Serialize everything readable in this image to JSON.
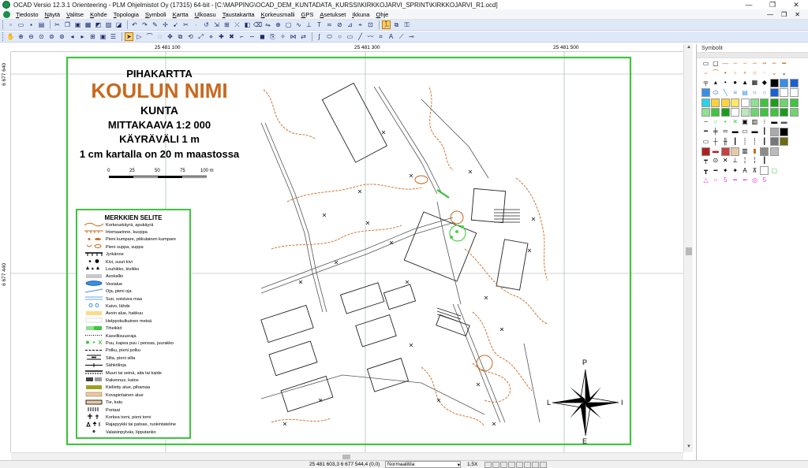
{
  "window": {
    "title": "OCAD Versio 12.3.1  Orienteering - PLM Ohjelmistot Oy (17315) 64-bit - [C:\\MAPPING\\OCAD_DEM_KUNTADATA_KURSSI\\KIRKKOJARVI_SPRINT\\KIRKKOJARVI_R1.ocd]",
    "minimize": "—",
    "maximize": "❐",
    "close": "✕"
  },
  "menu": [
    {
      "label": "Tiedosto"
    },
    {
      "label": "Näytä"
    },
    {
      "label": "Valitse"
    },
    {
      "label": "Kohde"
    },
    {
      "label": "Topologia"
    },
    {
      "label": "Symboli"
    },
    {
      "label": "Kartta"
    },
    {
      "label": "Ulkoasu"
    },
    {
      "label": "Taustakartta"
    },
    {
      "label": "Korkeusmalli"
    },
    {
      "label": "GPS"
    },
    {
      "label": "Asetukset"
    },
    {
      "label": "Ikkuna"
    },
    {
      "label": "Ohje"
    }
  ],
  "mdi_buttons": {
    "minimize": "—",
    "restore": "❐",
    "close": "✕"
  },
  "ruler": {
    "x_labels": [
      "25 481 100",
      "25 481 300",
      "25 481 500"
    ],
    "y_labels": [
      "6 677 640",
      "6 677 440"
    ]
  },
  "sheet": {
    "heading": "PIHAKARTTA",
    "school": "KOULUN NIMI",
    "municipality": "KUNTA",
    "scale": "MITTAKAAVA 1:2 000",
    "contour": "KÄYRÄVÄLI 1 m",
    "cm_note": "1 cm kartalla on 20 m maastossa",
    "scale_bar_labels": [
      "0",
      "25",
      "50",
      "75",
      "100 m"
    ],
    "compass": {
      "north": "P",
      "south": "E",
      "west": "L",
      "east": "I"
    }
  },
  "legend": {
    "title": "MERKKIEN SELITE",
    "items": [
      {
        "label": "Korkeuskäyrä, apukäyrä",
        "symbol": "contour-line"
      },
      {
        "label": "Irtomaarinne, kuoppa",
        "symbol": "earth-bank"
      },
      {
        "label": "Pieni kumpare, pitkulainen kumpare",
        "symbol": "knoll"
      },
      {
        "label": "Pieni suppa, suppa",
        "symbol": "depression"
      },
      {
        "label": "Jyrkänne",
        "symbol": "cliff"
      },
      {
        "label": "Kivi, suuri kivi",
        "symbol": "boulder"
      },
      {
        "label": "Louhikko, kivikko",
        "symbol": "boulder-field"
      },
      {
        "label": "Avokallio",
        "symbol": "bare-rock"
      },
      {
        "label": "Vesialue",
        "symbol": "water"
      },
      {
        "label": "Oja, pieni oja",
        "symbol": "ditch"
      },
      {
        "label": "Suo, soistuva maa",
        "symbol": "marsh"
      },
      {
        "label": "Kaivo, lähde",
        "symbol": "well"
      },
      {
        "label": "Avoin alue, hakkuu",
        "symbol": "open-land"
      },
      {
        "label": "Helppokulkuinen metsä",
        "symbol": "forest"
      },
      {
        "label": "Tiheikkö",
        "symbol": "thicket"
      },
      {
        "label": "Kasvillisuusraja",
        "symbol": "veg-boundary"
      },
      {
        "label": "Puu, kapea puu / pensas, juurakko",
        "symbol": "tree"
      },
      {
        "label": "Polku, pieni polku",
        "symbol": "path"
      },
      {
        "label": "Silta, pieni silta",
        "symbol": "bridge"
      },
      {
        "label": "Sähkölinja",
        "symbol": "power-line"
      },
      {
        "label": "Muuri tai seinä, aita tai kaide",
        "symbol": "wall"
      },
      {
        "label": "Rakennus, katos",
        "symbol": "building"
      },
      {
        "label": "Kielletty alue, pihamaa",
        "symbol": "forbidden"
      },
      {
        "label": "Kovapintainen alue",
        "symbol": "paved"
      },
      {
        "label": "Tie, katu",
        "symbol": "road"
      },
      {
        "label": "Portaat",
        "symbol": "stairs"
      },
      {
        "label": "Korkea torni, pieni torni",
        "symbol": "tower"
      },
      {
        "label": "Rajapyykki tai patsas, ruokintateline",
        "symbol": "monument"
      },
      {
        "label": "Valaisinpylväs, lipputanko",
        "symbol": "lamp-post"
      }
    ]
  },
  "symbols_panel": {
    "title": "Symbolit"
  },
  "status": {
    "coords": "25 481 603,3   6 677 544,4   (0,0)",
    "mode": "Normaalitila",
    "zoom": "1,5X"
  },
  "colors": {
    "brown": "#c8691f",
    "green_border": "#3fc43f",
    "toolbar": "#dfe8f7",
    "active_tool": "#ffcf6b"
  }
}
